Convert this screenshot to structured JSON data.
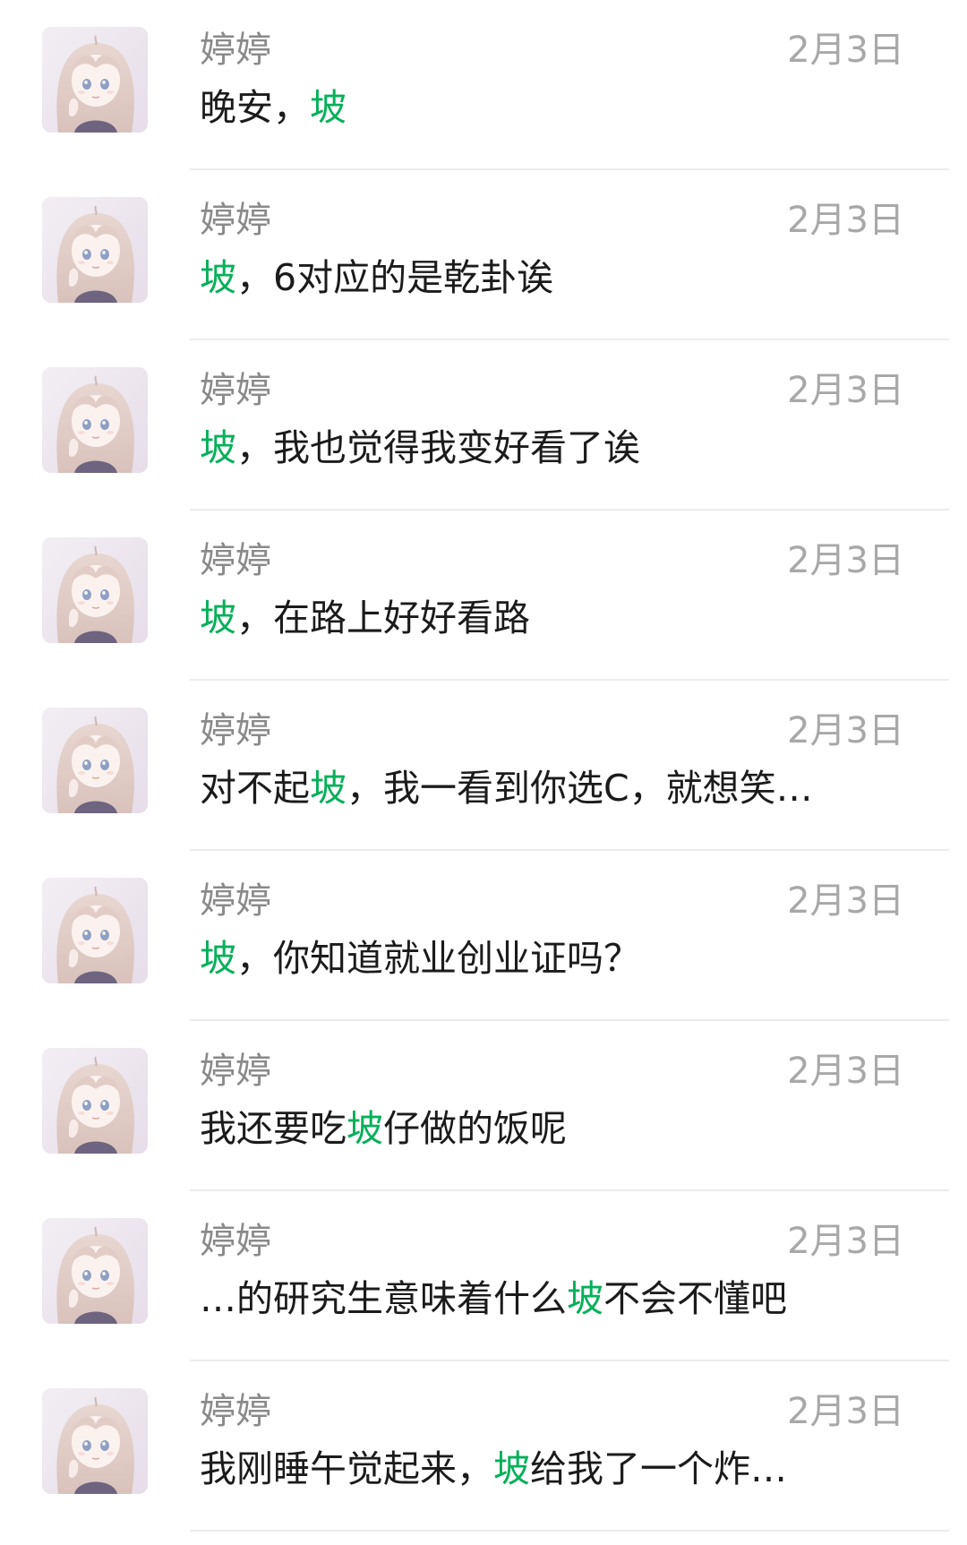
{
  "results": [
    {
      "sender": "婷婷",
      "date": "2月3日",
      "parts": [
        {
          "text": "晚安，",
          "hl": false
        },
        {
          "text": "坡",
          "hl": true
        }
      ]
    },
    {
      "sender": "婷婷",
      "date": "2月3日",
      "parts": [
        {
          "text": "坡",
          "hl": true
        },
        {
          "text": "，6对应的是乾卦诶",
          "hl": false
        }
      ]
    },
    {
      "sender": "婷婷",
      "date": "2月3日",
      "parts": [
        {
          "text": "坡",
          "hl": true
        },
        {
          "text": "，我也觉得我变好看了诶",
          "hl": false
        }
      ]
    },
    {
      "sender": "婷婷",
      "date": "2月3日",
      "parts": [
        {
          "text": "坡",
          "hl": true
        },
        {
          "text": "，在路上好好看路",
          "hl": false
        }
      ]
    },
    {
      "sender": "婷婷",
      "date": "2月3日",
      "parts": [
        {
          "text": "对不起",
          "hl": false
        },
        {
          "text": "坡",
          "hl": true
        },
        {
          "text": "，我一看到你选C，就想笑…",
          "hl": false
        }
      ]
    },
    {
      "sender": "婷婷",
      "date": "2月3日",
      "parts": [
        {
          "text": "坡",
          "hl": true
        },
        {
          "text": "，你知道就业创业证吗？",
          "hl": false
        }
      ]
    },
    {
      "sender": "婷婷",
      "date": "2月3日",
      "parts": [
        {
          "text": "我还要吃",
          "hl": false
        },
        {
          "text": "坡",
          "hl": true
        },
        {
          "text": "仔做的饭呢",
          "hl": false
        }
      ]
    },
    {
      "sender": "婷婷",
      "date": "2月3日",
      "parts": [
        {
          "text": "…的研究生意味着什么",
          "hl": false
        },
        {
          "text": "坡",
          "hl": true
        },
        {
          "text": "不会不懂吧",
          "hl": false
        }
      ]
    },
    {
      "sender": "婷婷",
      "date": "2月3日",
      "parts": [
        {
          "text": "我刚睡午觉起来，",
          "hl": false
        },
        {
          "text": "坡",
          "hl": true
        },
        {
          "text": "给我了一个炸…",
          "hl": false
        }
      ]
    }
  ],
  "colors": {
    "highlight": "#07b05a",
    "sender": "#8a8a8a",
    "date": "#a8a8a8",
    "message": "#1b1b1b",
    "divider": "#ececec"
  },
  "icons": {
    "avatar": "anime-girl-avatar"
  }
}
